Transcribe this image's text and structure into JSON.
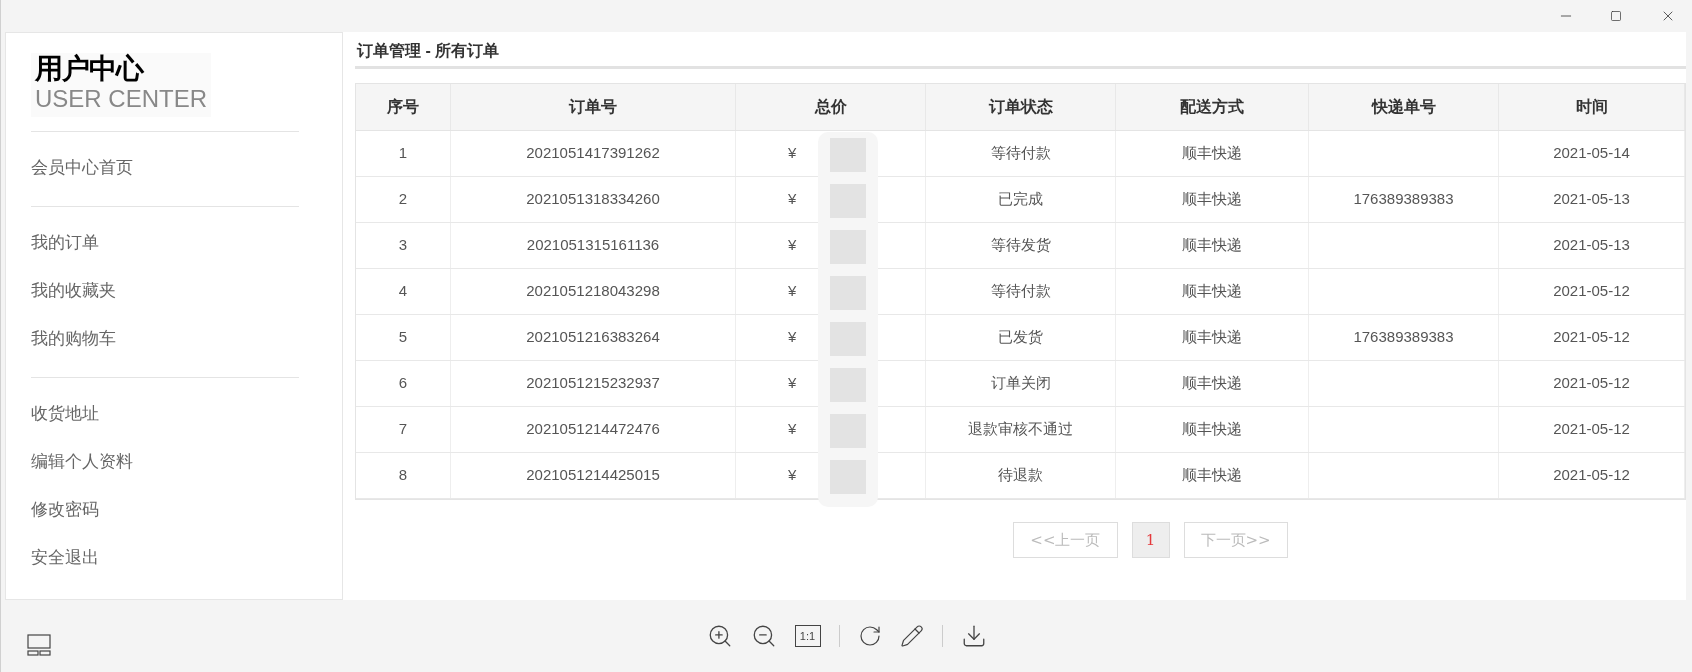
{
  "sidebar": {
    "logo_title": "用户中心",
    "logo_subtitle": "USER CENTER",
    "groups": [
      {
        "items": [
          {
            "label": "会员中心首页"
          }
        ]
      },
      {
        "items": [
          {
            "label": "我的订单"
          },
          {
            "label": "我的收藏夹"
          },
          {
            "label": "我的购物车"
          }
        ]
      },
      {
        "items": [
          {
            "label": "收货地址"
          },
          {
            "label": "编辑个人资料"
          },
          {
            "label": "修改密码"
          },
          {
            "label": "安全退出"
          }
        ]
      }
    ]
  },
  "page_title": "订单管理 - 所有订单",
  "table": {
    "columns": [
      "序号",
      "订单号",
      "总价",
      "订单状态",
      "配送方式",
      "快递单号",
      "时间"
    ],
    "rows": [
      [
        "1",
        "2021051417391262",
        "¥",
        "等待付款",
        "顺丰快递",
        "",
        "2021-05-14"
      ],
      [
        "2",
        "2021051318334260",
        "¥",
        "已完成",
        "顺丰快递",
        "176389389383",
        "2021-05-13"
      ],
      [
        "3",
        "2021051315161136",
        "¥",
        "等待发货",
        "顺丰快递",
        "",
        "2021-05-13"
      ],
      [
        "4",
        "2021051218043298",
        "¥",
        "等待付款",
        "顺丰快递",
        "",
        "2021-05-12"
      ],
      [
        "5",
        "2021051216383264",
        "¥",
        "已发货",
        "顺丰快递",
        "176389389383",
        "2021-05-12"
      ],
      [
        "6",
        "2021051215232937",
        "¥",
        "订单关闭",
        "顺丰快递",
        "",
        "2021-05-12"
      ],
      [
        "7",
        "2021051214472476",
        "¥",
        "退款审核不通过",
        "顺丰快递",
        "",
        "2021-05-12"
      ],
      [
        "8",
        "2021051214425015",
        "¥",
        "待退款",
        "顺丰快递",
        "",
        "2021-05-12"
      ]
    ]
  },
  "pagination": {
    "prev": "<<上一页",
    "pages": [
      {
        "label": "1",
        "selected": true
      }
    ],
    "next": "下一页>>",
    "prev_disabled": true,
    "next_disabled": true
  },
  "toolbar": {
    "actual_size_label": "1:1"
  }
}
